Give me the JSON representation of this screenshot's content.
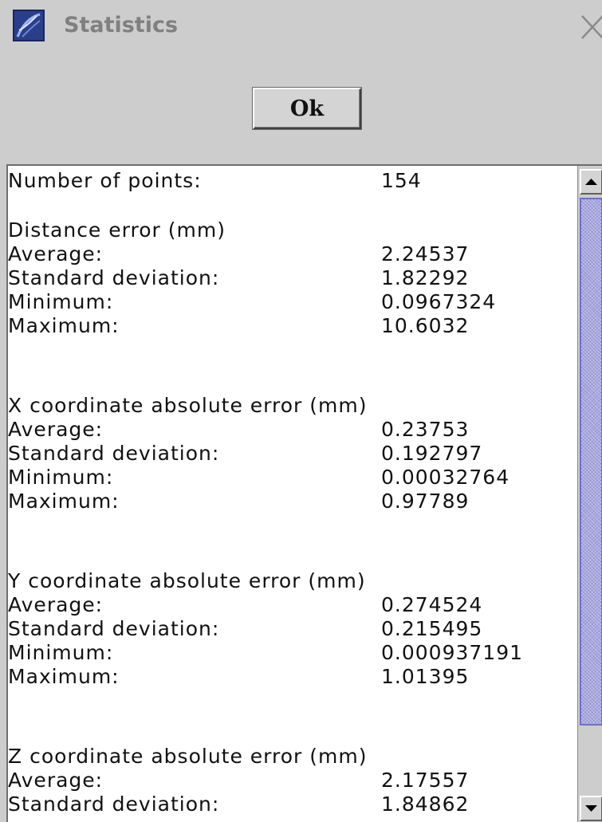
{
  "window": {
    "title": "Statistics",
    "close_glyph": "✕",
    "app_icon": "app-logo-icon"
  },
  "buttons": {
    "ok_label": "Ok"
  },
  "stats": {
    "points": {
      "label": "Number of points:",
      "value": "154"
    },
    "distance": {
      "heading": "Distance error (mm)",
      "rows": [
        {
          "label": "Average:",
          "value": "2.24537"
        },
        {
          "label": "Standard deviation:",
          "value": "1.82292"
        },
        {
          "label": "Minimum:",
          "value": "0.0967324"
        },
        {
          "label": "Maximum:",
          "value": "10.6032"
        }
      ]
    },
    "x_coord": {
      "heading": "X coordinate absolute error (mm)",
      "rows": [
        {
          "label": "Average:",
          "value": "0.23753"
        },
        {
          "label": "Standard deviation:",
          "value": "0.192797"
        },
        {
          "label": "Minimum:",
          "value": "0.00032764"
        },
        {
          "label": "Maximum:",
          "value": "0.97789"
        }
      ]
    },
    "y_coord": {
      "heading": "Y coordinate absolute error (mm)",
      "rows": [
        {
          "label": "Average:",
          "value": "0.274524"
        },
        {
          "label": "Standard deviation:",
          "value": "0.215495"
        },
        {
          "label": "Minimum:",
          "value": "0.000937191"
        },
        {
          "label": "Maximum:",
          "value": "1.01395"
        }
      ]
    },
    "z_coord": {
      "heading": "Z coordinate absolute error (mm)",
      "rows": [
        {
          "label": "Average:",
          "value": "2.17557"
        },
        {
          "label": "Standard deviation:",
          "value": "1.84862"
        }
      ]
    }
  },
  "scrollbar": {
    "up_icon": "arrow-up-icon",
    "down_icon": "arrow-down-icon"
  },
  "colors": {
    "window_bg": "#cdcdcd",
    "title_text": "#808080",
    "scroll_thumb": "#a8a8e0"
  }
}
